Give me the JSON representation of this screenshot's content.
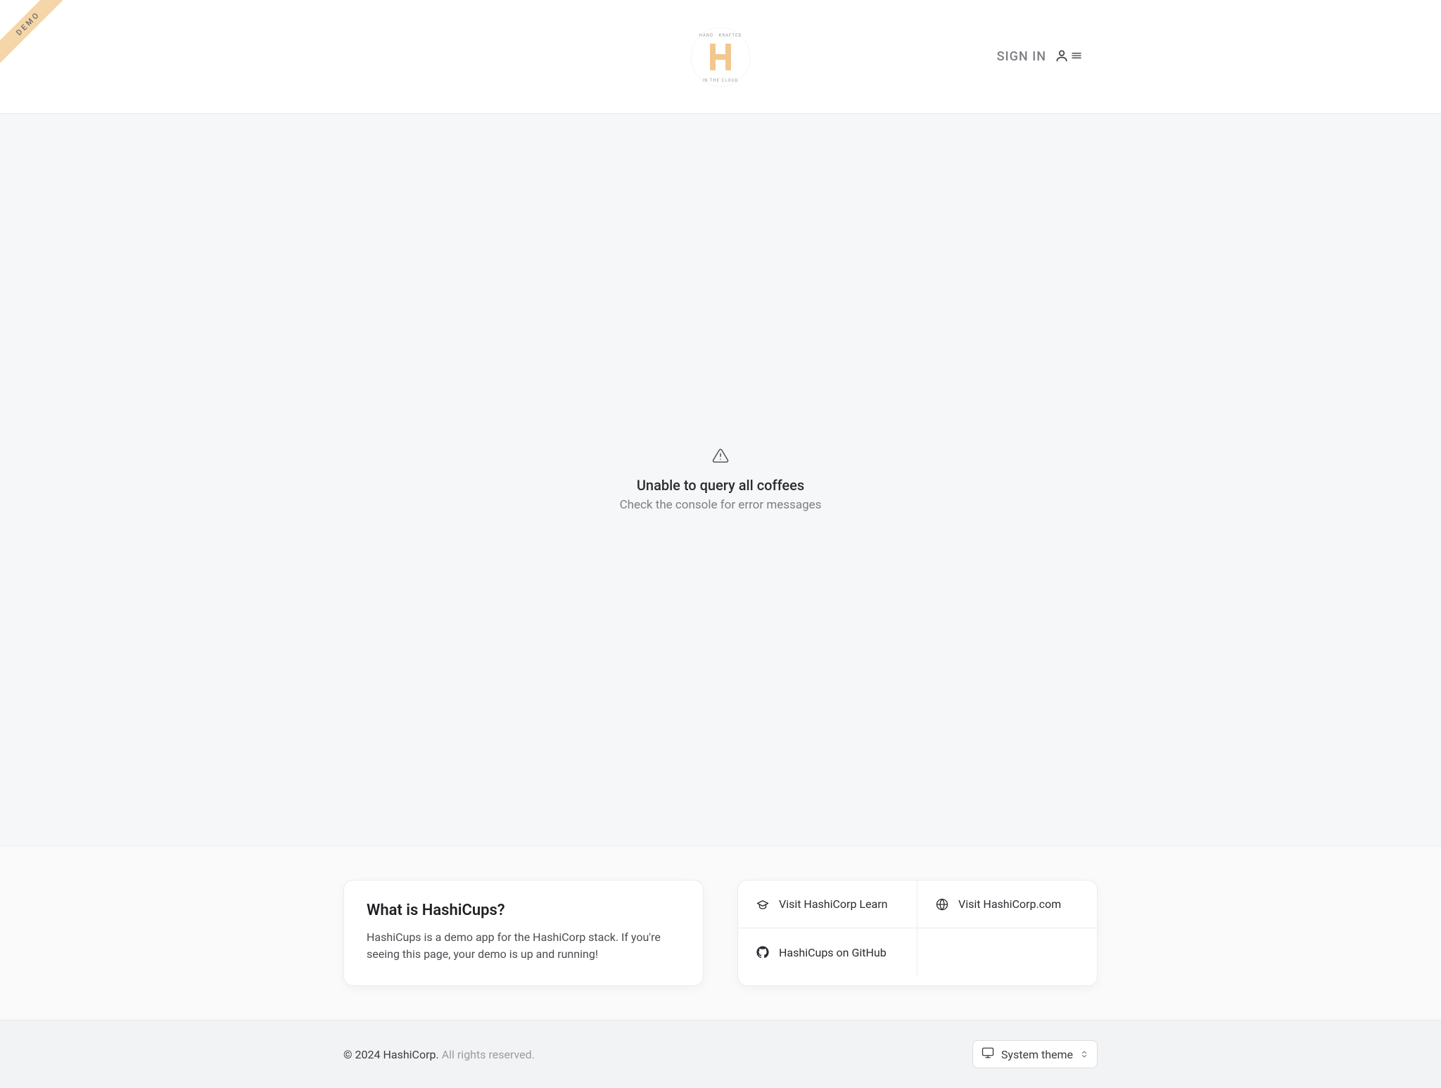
{
  "ribbon": {
    "label": "DEMO"
  },
  "header": {
    "sign_in_label": "SIGN IN"
  },
  "main": {
    "error_title": "Unable to query all coffees",
    "error_subtitle": "Check the console for error messages"
  },
  "info_card": {
    "title": "What is HashiCups?",
    "body": "HashiCups is a demo app for the HashiCorp stack. If you're seeing this page, your demo is up and running!"
  },
  "links": {
    "learn": "Visit HashiCorp Learn",
    "site": "Visit HashiCorp.com",
    "github": "HashiCups on GitHub"
  },
  "footer": {
    "copyright_strong": "© 2024 HashiCorp.",
    "copyright_muted": "All rights reserved.",
    "theme_label": "System theme"
  }
}
